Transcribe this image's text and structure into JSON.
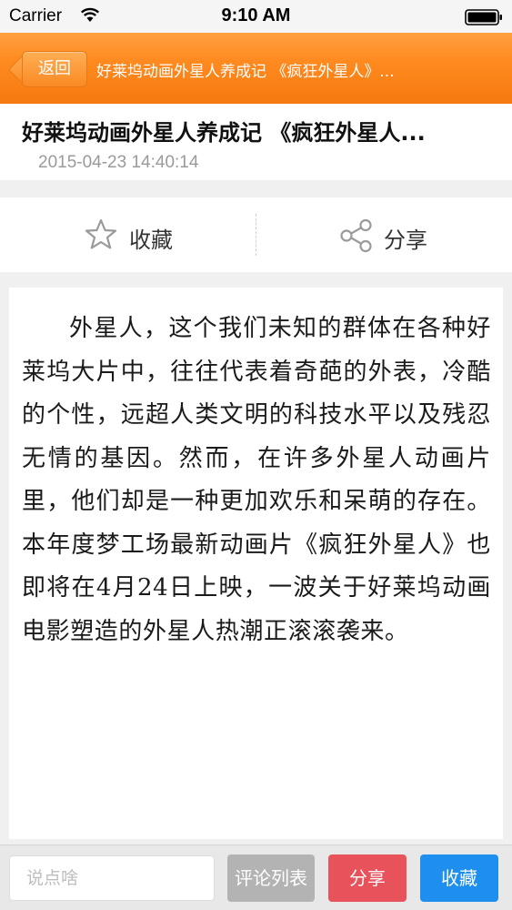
{
  "status_bar": {
    "carrier": "Carrier",
    "time": "9:10 AM"
  },
  "nav": {
    "back_label": "返回",
    "title": "好莱坞动画外星人养成记 《疯狂外星人》..."
  },
  "article": {
    "title": "好莱坞动画外星人养成记 《疯狂外星人...",
    "date": "2015-04-23 14:40:14",
    "body": "外星人，这个我们未知的群体在各种好莱坞大片中，往往代表着奇葩的外表，冷酷的个性，远超人类文明的科技水平以及残忍无情的基因。然而，在许多外星人动画片里，他们却是一种更加欢乐和呆萌的存在。本年度梦工场最新动画片《疯狂外星人》也即将在4月24日上映，一波关于好莱坞动画电影塑造的外星人热潮正滚滚袭来。"
  },
  "actions": {
    "favorite_label": "收藏",
    "share_label": "分享"
  },
  "bottom_bar": {
    "comment_placeholder": "说点啥",
    "comments_list_label": "评论列表",
    "share_label": "分享",
    "favorite_label": "收藏"
  },
  "colors": {
    "nav_orange": "#f98a23",
    "share_red": "#e8525a",
    "favorite_blue": "#1e8fef",
    "disabled_gray": "#b3b3b3"
  },
  "icons": {
    "wifi": "wifi-icon",
    "battery": "battery-icon",
    "favorite": "star-icon",
    "share": "share-icon"
  }
}
